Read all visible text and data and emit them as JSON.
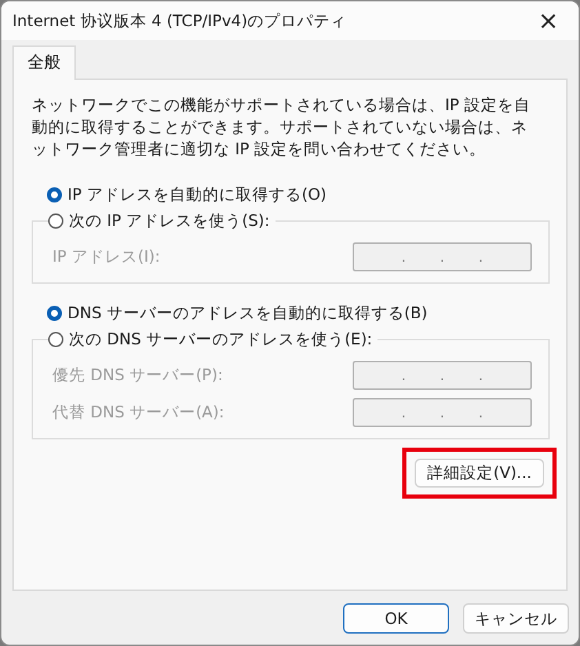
{
  "window": {
    "title": "Internet 协议版本 4 (TCP/IPv4)のプロパティ",
    "close": "×"
  },
  "tabs": [
    {
      "label": "全般",
      "selected": true
    }
  ],
  "description": "ネットワークでこの機能がサポートされている場合は、IP 設定を自動的に取得することができます。サポートされていない場合は、ネットワーク管理者に適切な IP 設定を問い合わせてください。",
  "sections": [
    {
      "auto_option": {
        "label": "IP アドレスを自動的に取得する(O)",
        "selected": true
      },
      "manual_option": {
        "label": "次の IP アドレスを使う(S):",
        "selected": false
      },
      "fields": [
        {
          "label": "IP アドレス(I):",
          "disabled": true,
          "separators": [
            ".",
            ".",
            "."
          ]
        }
      ]
    },
    {
      "auto_option": {
        "label": "DNS サーバーのアドレスを自動的に取得する(B)",
        "selected": true
      },
      "manual_option": {
        "label": "次の DNS サーバーのアドレスを使う(E):",
        "selected": false
      },
      "fields": [
        {
          "label": "優先 DNS サーバー(P):",
          "disabled": true,
          "separators": [
            ".",
            ".",
            "."
          ]
        },
        {
          "label": "代替 DNS サーバー(A):",
          "disabled": true,
          "separators": [
            ".",
            ".",
            "."
          ]
        }
      ]
    }
  ],
  "advanced_button": {
    "label": "詳細設定(V)...",
    "highlighted": true
  },
  "buttons": [
    {
      "label": "OK",
      "default": true
    },
    {
      "label": "キャンセル",
      "default": false
    }
  ]
}
